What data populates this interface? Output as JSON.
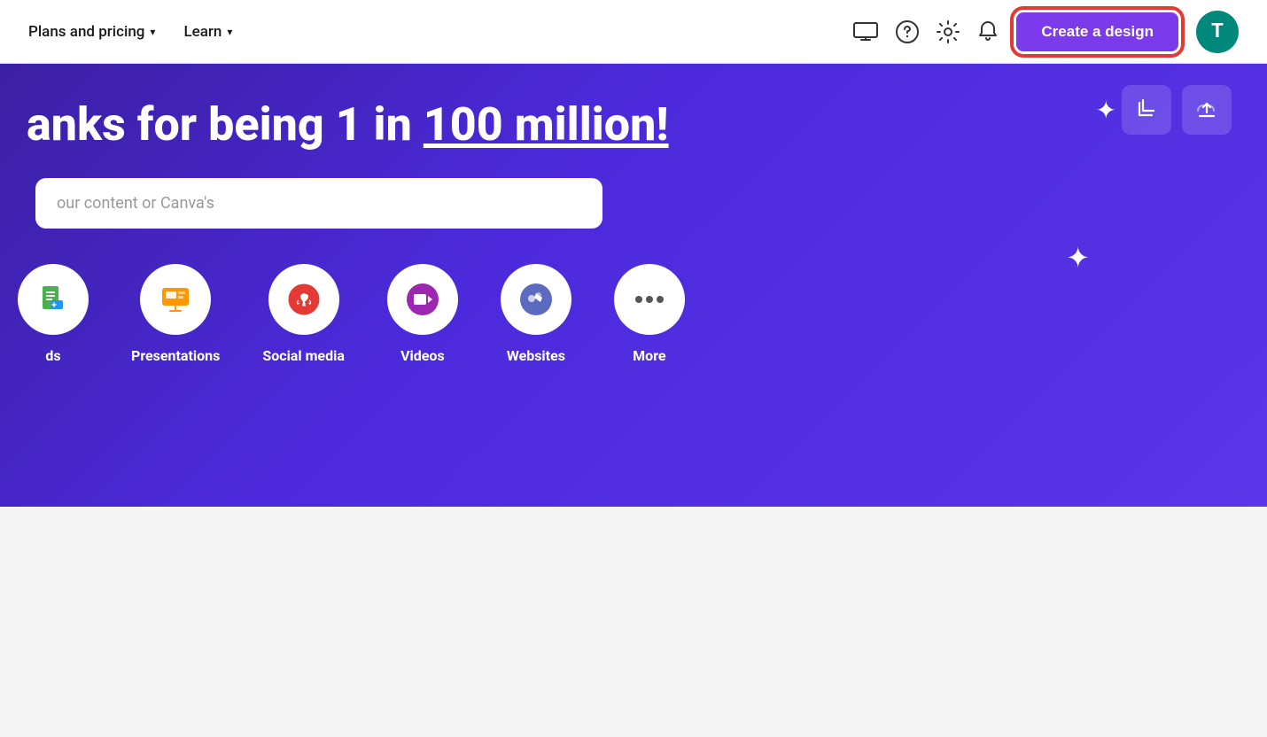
{
  "navbar": {
    "plans_label": "Plans and pricing",
    "learn_label": "Learn",
    "create_button": "Create a design",
    "avatar_letter": "T"
  },
  "hero": {
    "title_part1": "anks for being 1 in ",
    "title_highlight": "100 million!",
    "search_placeholder": "our content or Canva's"
  },
  "categories": [
    {
      "id": "docs",
      "label": "ds",
      "icon": "docs"
    },
    {
      "id": "presentations",
      "label": "Presentations",
      "icon": "presentations"
    },
    {
      "id": "social-media",
      "label": "Social media",
      "icon": "social"
    },
    {
      "id": "videos",
      "label": "Videos",
      "icon": "videos"
    },
    {
      "id": "websites",
      "label": "Websites",
      "icon": "websites"
    },
    {
      "id": "more",
      "label": "More",
      "icon": "more"
    }
  ]
}
